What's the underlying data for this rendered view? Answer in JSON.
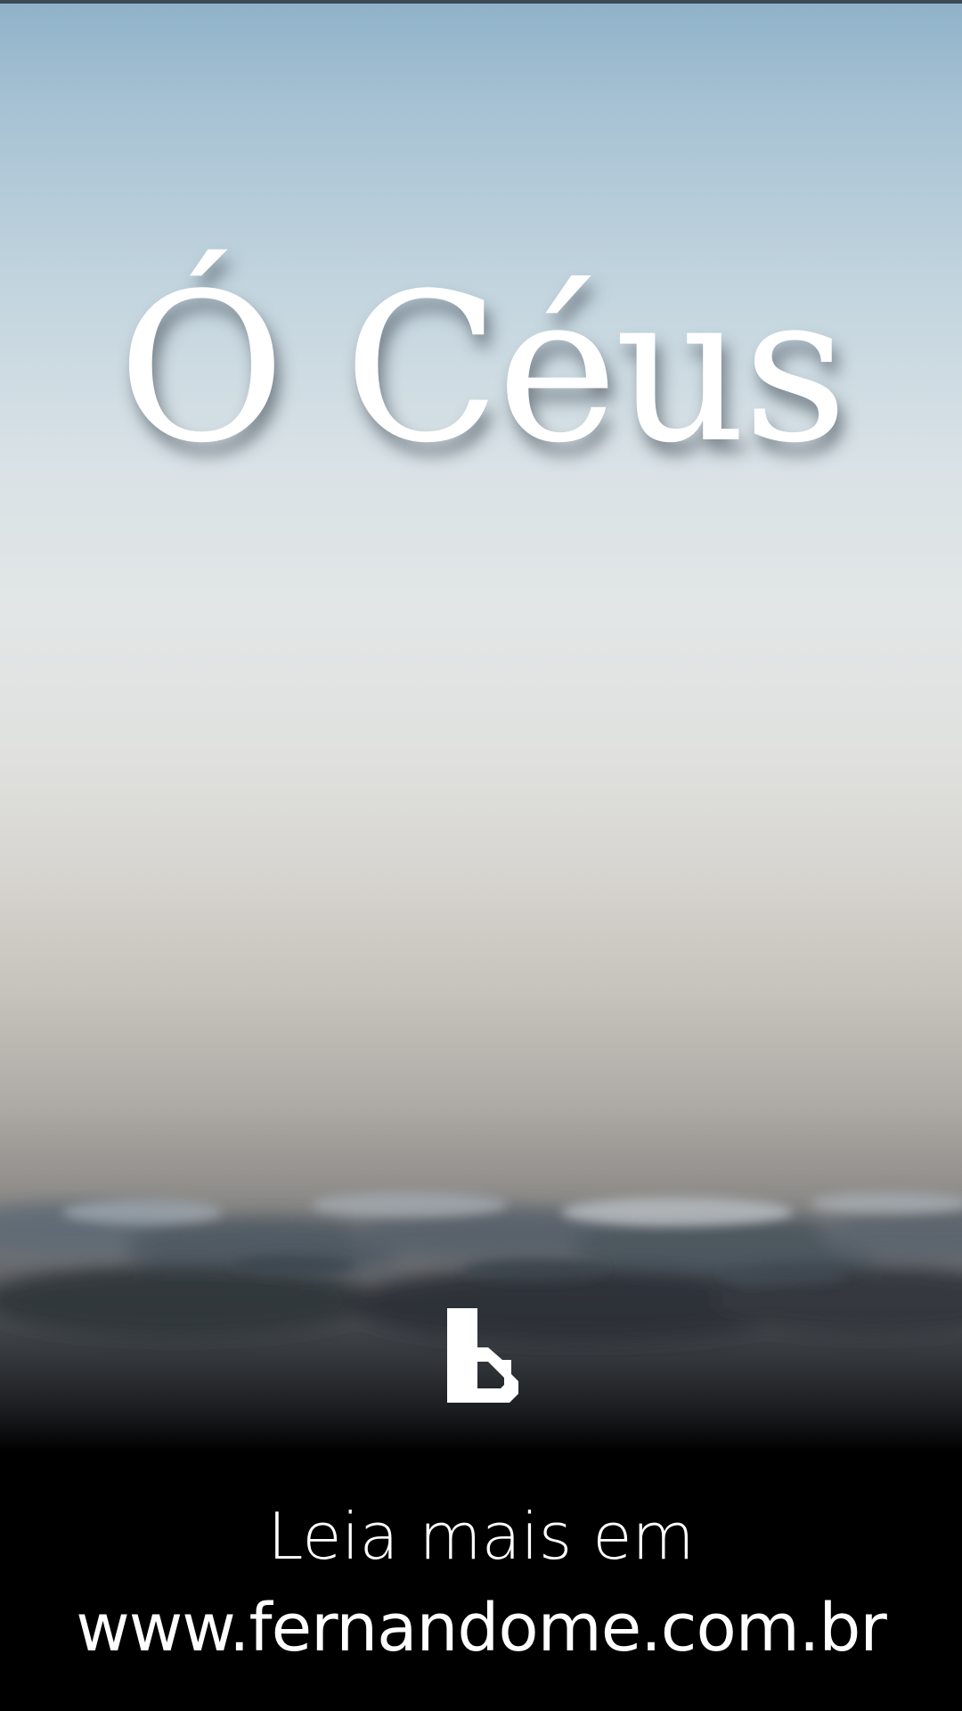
{
  "poster": {
    "title": "Ó Céus",
    "logo_icon": "bible-b-logo-icon",
    "footer": {
      "line1": "Leia mais em",
      "line2": "www.fernandome.com.br"
    }
  },
  "colors": {
    "sky_top": "#8fb2c9",
    "sky_mid": "#e2e6e6",
    "footer_bg": "#000000",
    "text": "#ffffff"
  }
}
